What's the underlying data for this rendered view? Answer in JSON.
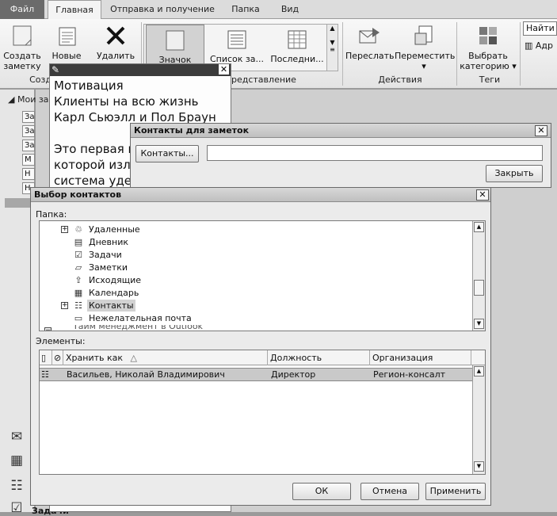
{
  "ribbon": {
    "tabs": [
      "Файл",
      "Главная",
      "Отправка и получение",
      "Папка",
      "Вид"
    ],
    "buttons": {
      "create_note": "Создать заметку",
      "new_items": "Новые",
      "delete": "Удалить",
      "view_icon": "Значок",
      "view_list": "Список за...",
      "view_last": "Последни...",
      "forward": "Переслать",
      "move": "Переместить",
      "categorize": "Выбрать категорию",
      "search_placeholder": "Найти к",
      "address_book": "Адр"
    },
    "groups": {
      "create": "Созд",
      "view": "редставление",
      "actions": "Действия",
      "tags": "Теги"
    }
  },
  "nav": {
    "root": "Мои за",
    "items": [
      "За",
      "За",
      "За",
      "М",
      "Н",
      "Н"
    ]
  },
  "note": {
    "lines": [
      "Мотивация",
      "Клиенты на всю жизнь",
      "Карл Сьюэлл и Пол Браун",
      "",
      "Это первая в",
      "которой изло",
      "система удер"
    ]
  },
  "contacts_dialog": {
    "title": "Контакты для заметок",
    "contacts_button": "Контакты...",
    "field_value": "",
    "close_button": "Закрыть"
  },
  "picker": {
    "title": "Выбор контактов",
    "folder_label": "Папка:",
    "folders": [
      {
        "label": "Удаленные",
        "icon": "trash-icon",
        "expander": "+"
      },
      {
        "label": "Дневник",
        "icon": "journal-icon",
        "expander": ""
      },
      {
        "label": "Задачи",
        "icon": "tasks-icon",
        "expander": ""
      },
      {
        "label": "Заметки",
        "icon": "notes-icon",
        "expander": ""
      },
      {
        "label": "Исходящие",
        "icon": "outbox-icon",
        "expander": ""
      },
      {
        "label": "Календарь",
        "icon": "calendar-icon",
        "expander": ""
      },
      {
        "label": "Контакты",
        "icon": "contacts-icon",
        "expander": "+"
      },
      {
        "label": "Нежелательная почта",
        "icon": "junk-folder-icon",
        "expander": ""
      }
    ],
    "folder_cut": "Тайм менеджмент в Outlook",
    "items_label": "Элементы:",
    "columns": [
      "Хранить как",
      "Должность",
      "Организация"
    ],
    "rows": [
      {
        "name": "Васильев, Николай Владимирович",
        "position": "Директор",
        "company": "Регион-консалт"
      }
    ],
    "ok": "ОК",
    "cancel": "Отмена",
    "apply": "Применить"
  },
  "bottom_label": "Задачи"
}
